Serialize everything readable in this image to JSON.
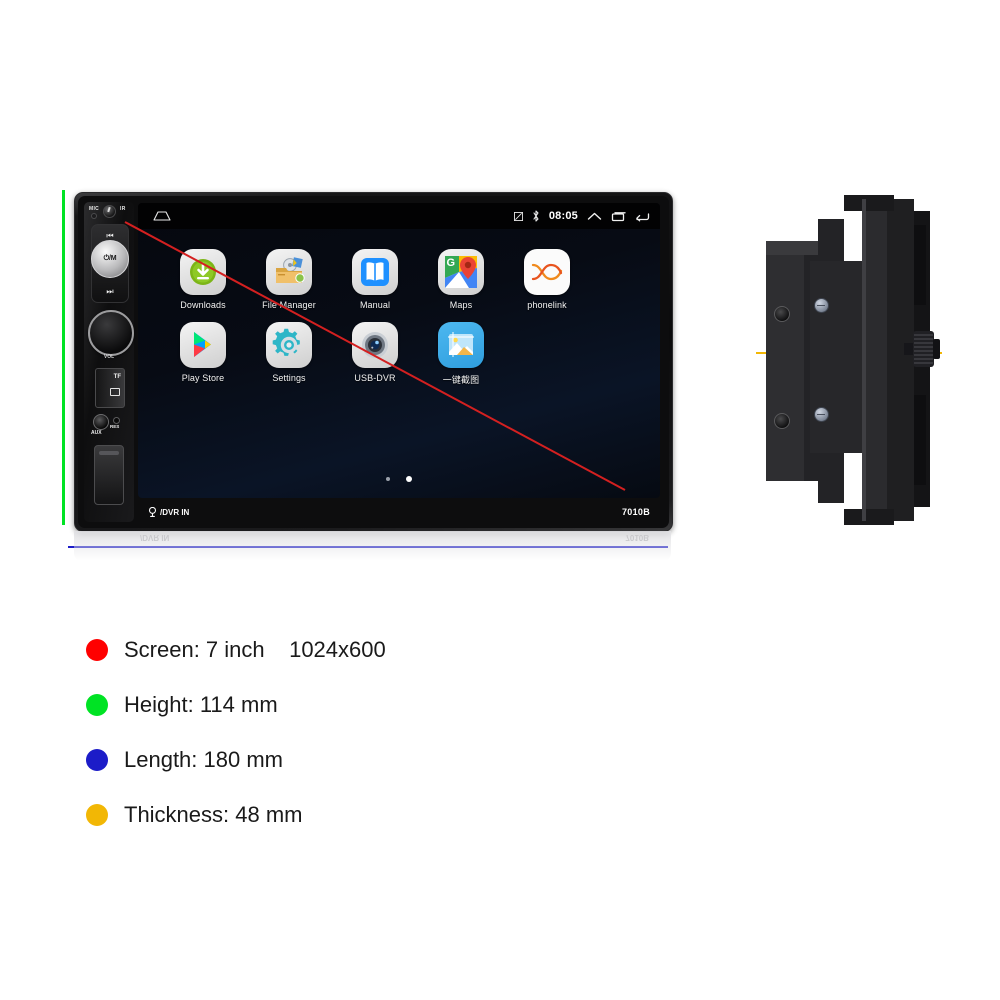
{
  "product": {
    "model": "7010B",
    "bottom_bezel_label": "/DVR IN",
    "left_panel": {
      "mic_label": "MIC",
      "ir_label": "IR",
      "power_label": "⏻/M",
      "prev_label": "⏮",
      "next_label": "⏭",
      "volume_label": "VOL",
      "tf_label": "TF",
      "aux_label": "AUX",
      "res_label": "RES"
    }
  },
  "status_bar": {
    "time": "08:05",
    "icons": [
      "signal-icon",
      "bluetooth-icon",
      "chevron-up-icon",
      "recents-icon",
      "back-icon"
    ]
  },
  "home_screen": {
    "rows": [
      [
        {
          "label": "Downloads",
          "icon": "downloads-icon"
        },
        {
          "label": "File Manager",
          "icon": "file-manager-icon"
        },
        {
          "label": "Manual",
          "icon": "manual-icon"
        },
        {
          "label": "Maps",
          "icon": "maps-icon"
        },
        {
          "label": "phonelink",
          "icon": "phonelink-icon"
        }
      ],
      [
        {
          "label": "Play Store",
          "icon": "play-store-icon"
        },
        {
          "label": "Settings",
          "icon": "settings-icon"
        },
        {
          "label": "USB-DVR",
          "icon": "usb-dvr-icon"
        },
        {
          "label": "一键截图",
          "icon": "screenshot-icon"
        }
      ]
    ],
    "page_dots": 2,
    "active_dot": 2
  },
  "specs": [
    {
      "color": "#ff0000",
      "text": "Screen: 7 inch    1024x600"
    },
    {
      "color": "#00e324",
      "text": "Height: 114 mm"
    },
    {
      "color": "#1c1cc8",
      "text": "Length: 180 mm"
    },
    {
      "color": "#f2b705",
      "text": "Thickness: 48 mm"
    }
  ],
  "guide_lines": {
    "screen_diagonal_color": "#d42020",
    "height_color": "#00e324",
    "length_color": "#1c1cc8",
    "thickness_color": "#f2b705"
  }
}
